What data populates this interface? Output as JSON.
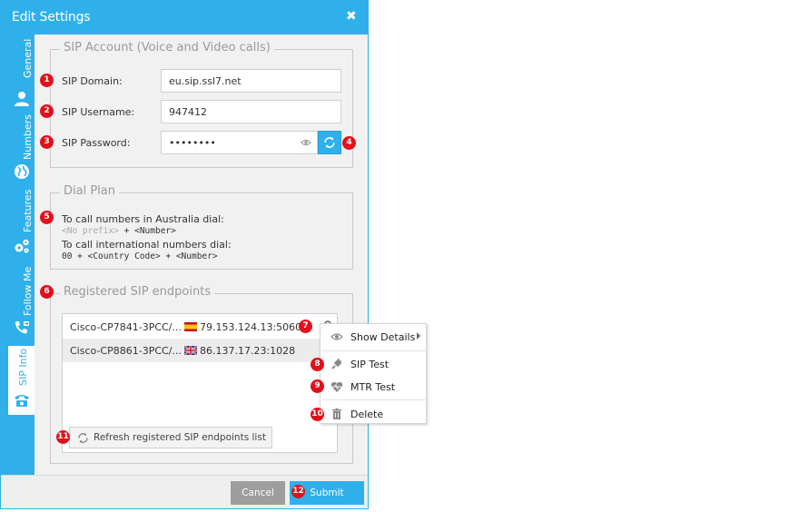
{
  "dialog": {
    "title": "Edit Settings",
    "close_glyph": "✖"
  },
  "nav": {
    "tabs": [
      {
        "label": "General",
        "icon": "user-icon"
      },
      {
        "label": "Numbers",
        "icon": "globe-icon"
      },
      {
        "label": "Features",
        "icon": "gears-icon"
      },
      {
        "label": "Follow Me",
        "icon": "phone-forward-icon"
      },
      {
        "label": "SIP Info",
        "icon": "desk-phone-icon",
        "active": true
      }
    ]
  },
  "sip_account": {
    "legend": "SIP Account (Voice and Video calls)",
    "domain_label": "SIP Domain:",
    "domain_value": "eu.sip.ssl7.net",
    "username_label": "SIP Username:",
    "username_value": "947412",
    "password_label": "SIP Password:",
    "password_value": "••••••••"
  },
  "dial_plan": {
    "legend": "Dial Plan",
    "line1": "To call numbers in Australia dial:",
    "line2_prefix": "<No prefix>",
    "line2_rest": "+ <Number>",
    "line3": "To call international numbers dial:",
    "line4": "00 + <Country Code> + <Number>"
  },
  "endpoints": {
    "legend": "Registered SIP endpoints",
    "rows": [
      {
        "name": "Cisco-CP7841-3PCC/...",
        "flag": "spain-flag-icon",
        "ip": "79.153.124.13:5060"
      },
      {
        "name": "Cisco-CP8861-3PCC/...",
        "flag": "uk-flag-icon",
        "ip": "86.137.17.23:1028"
      }
    ],
    "refresh_label": "Refresh registered SIP endpoints list"
  },
  "context_menu": {
    "show_details": "Show Details",
    "sip_test": "SIP Test",
    "mtr_test": "MTR Test",
    "delete": "Delete"
  },
  "footer": {
    "cancel": "Cancel",
    "submit": "Submit"
  },
  "badges": [
    "1",
    "2",
    "3",
    "4",
    "5",
    "6",
    "7",
    "8",
    "9",
    "10",
    "11",
    "12"
  ],
  "colors": {
    "accent": "#2fb0ea",
    "badge": "#e3101b",
    "cancel": "#9e9e9e"
  }
}
